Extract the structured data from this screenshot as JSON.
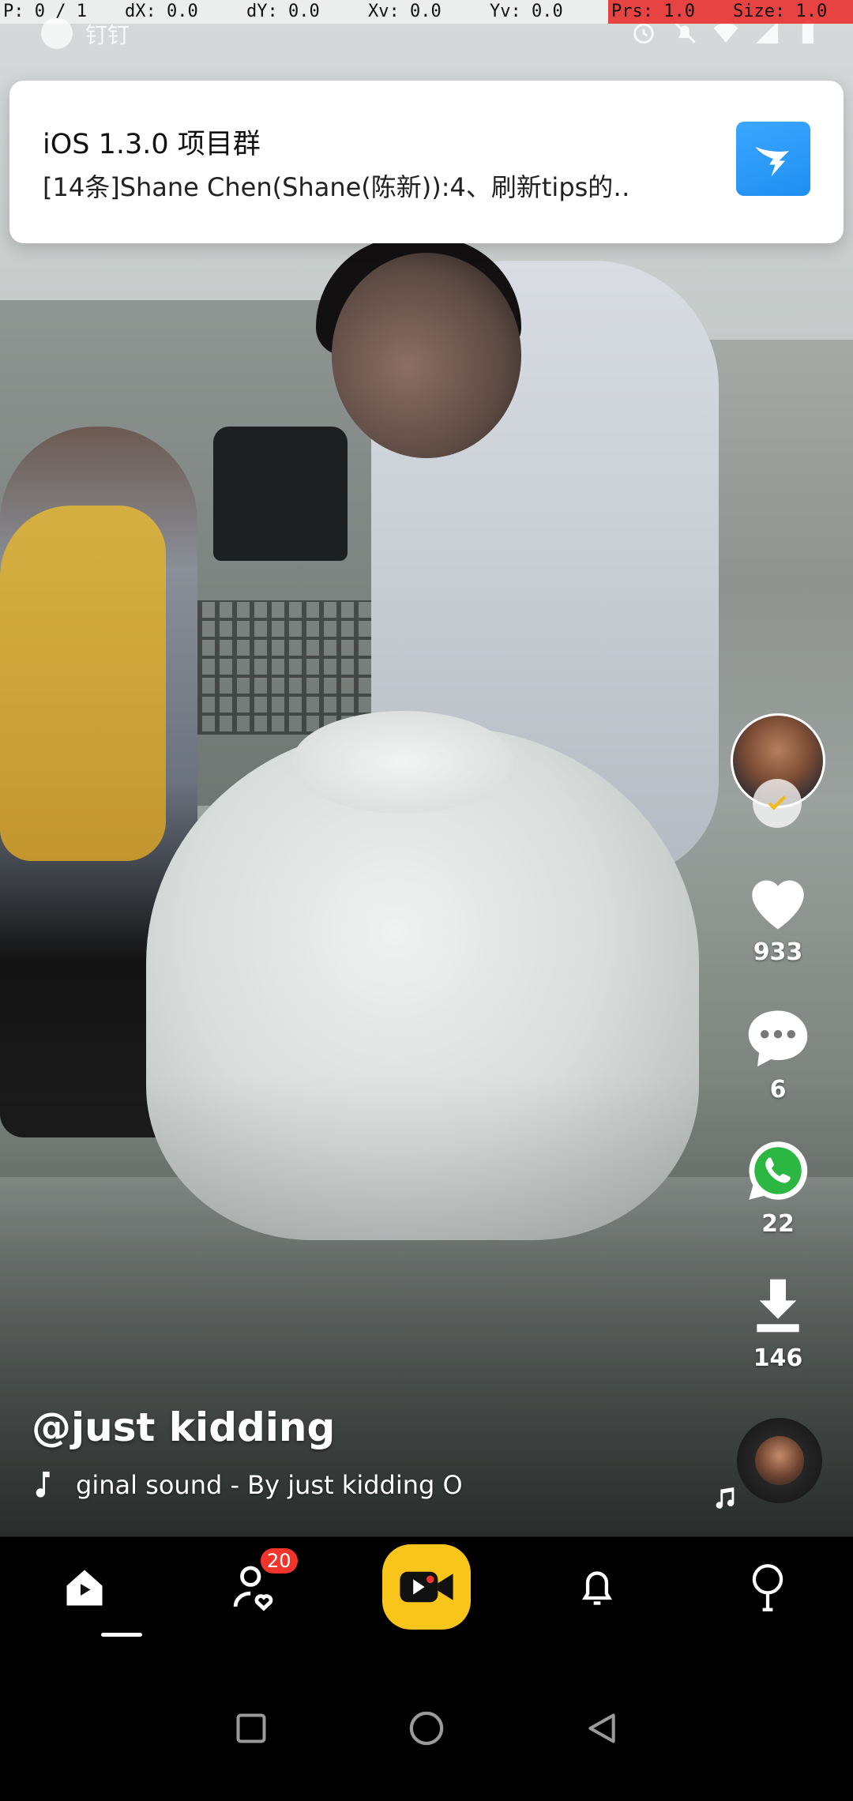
{
  "debug": {
    "pointer": "P: 0 / 1",
    "dx": "dX: 0.0",
    "dy": "dY: 0.0",
    "xv": "Xv: 0.0",
    "yv": "Yv: 0.0",
    "prs": "Prs: 1.0",
    "size": "Size: 1.0"
  },
  "status_bar": {
    "app_name": "钉钉",
    "icons": [
      "alarm-icon",
      "bell-muted-icon",
      "wifi-icon",
      "signal-icon",
      "battery-icon"
    ]
  },
  "notification": {
    "title": "iOS 1.3.0 项目群",
    "body": "[14条]Shane Chen(Shane(陈新)):4、刷新tips的‥",
    "icon": "dingtalk-icon",
    "icon_color": "#2a9af8"
  },
  "actions": {
    "likes": "933",
    "comments": "6",
    "shares": "22",
    "downloads": "146"
  },
  "caption": {
    "username": "@just kidding",
    "sound": "ginal sound - By just kidding   O"
  },
  "bottom_nav": {
    "items": [
      "home",
      "friends",
      "record",
      "notifications",
      "profile"
    ],
    "active": "home",
    "friends_badge": "20",
    "record_color": "#f9c51a",
    "badge_color": "#f2352c"
  },
  "system_nav": [
    "recents",
    "home",
    "back"
  ]
}
